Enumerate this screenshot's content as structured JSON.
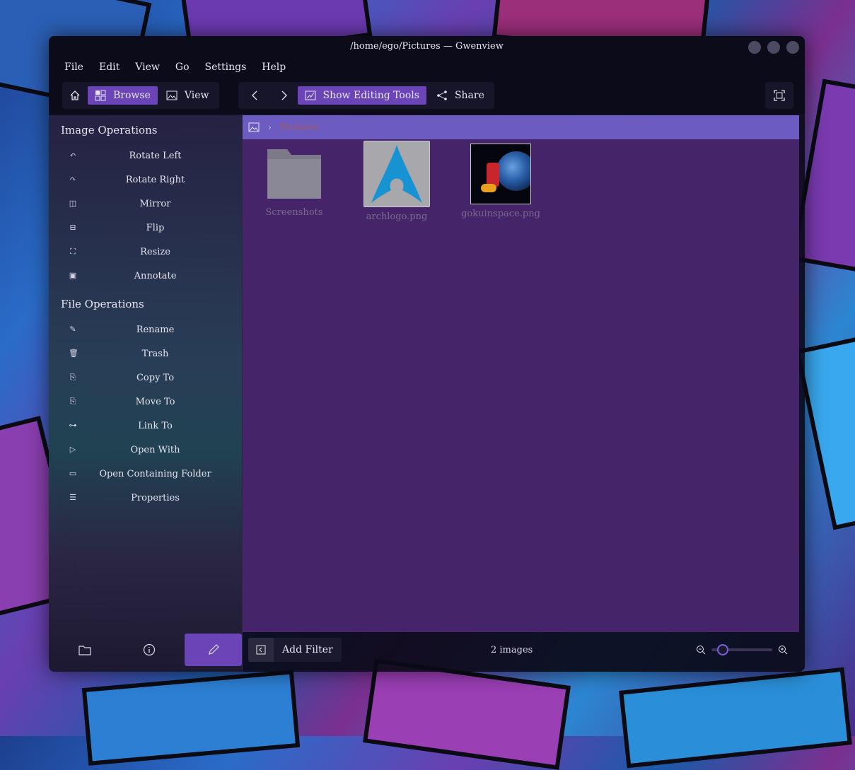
{
  "window": {
    "title": "/home/ego/Pictures — Gwenview"
  },
  "menu": [
    "File",
    "Edit",
    "View",
    "Go",
    "Settings",
    "Help"
  ],
  "toolbar": {
    "browse": "Browse",
    "view": "View",
    "show_editing_tools": "Show Editing Tools",
    "share": "Share"
  },
  "sidebar": {
    "image_ops_title": "Image Operations",
    "image_ops": [
      "Rotate Left",
      "Rotate Right",
      "Mirror",
      "Flip",
      "Resize",
      "Annotate"
    ],
    "file_ops_title": "File Operations",
    "file_ops": [
      "Rename",
      "Trash",
      "Copy To",
      "Move To",
      "Link To",
      "Open With",
      "Open Containing Folder",
      "Properties"
    ]
  },
  "breadcrumb": {
    "current": "Pictures"
  },
  "items": [
    {
      "name": "Screenshots",
      "type": "folder"
    },
    {
      "name": "archlogo.png",
      "type": "image"
    },
    {
      "name": "gokuinspace.png",
      "type": "image"
    }
  ],
  "status": {
    "add_filter": "Add Filter",
    "count": "2 images"
  },
  "colors": {
    "accent": "#6b44b8",
    "main_bg": "#462469",
    "crumb_bg": "#6c5bc0"
  }
}
